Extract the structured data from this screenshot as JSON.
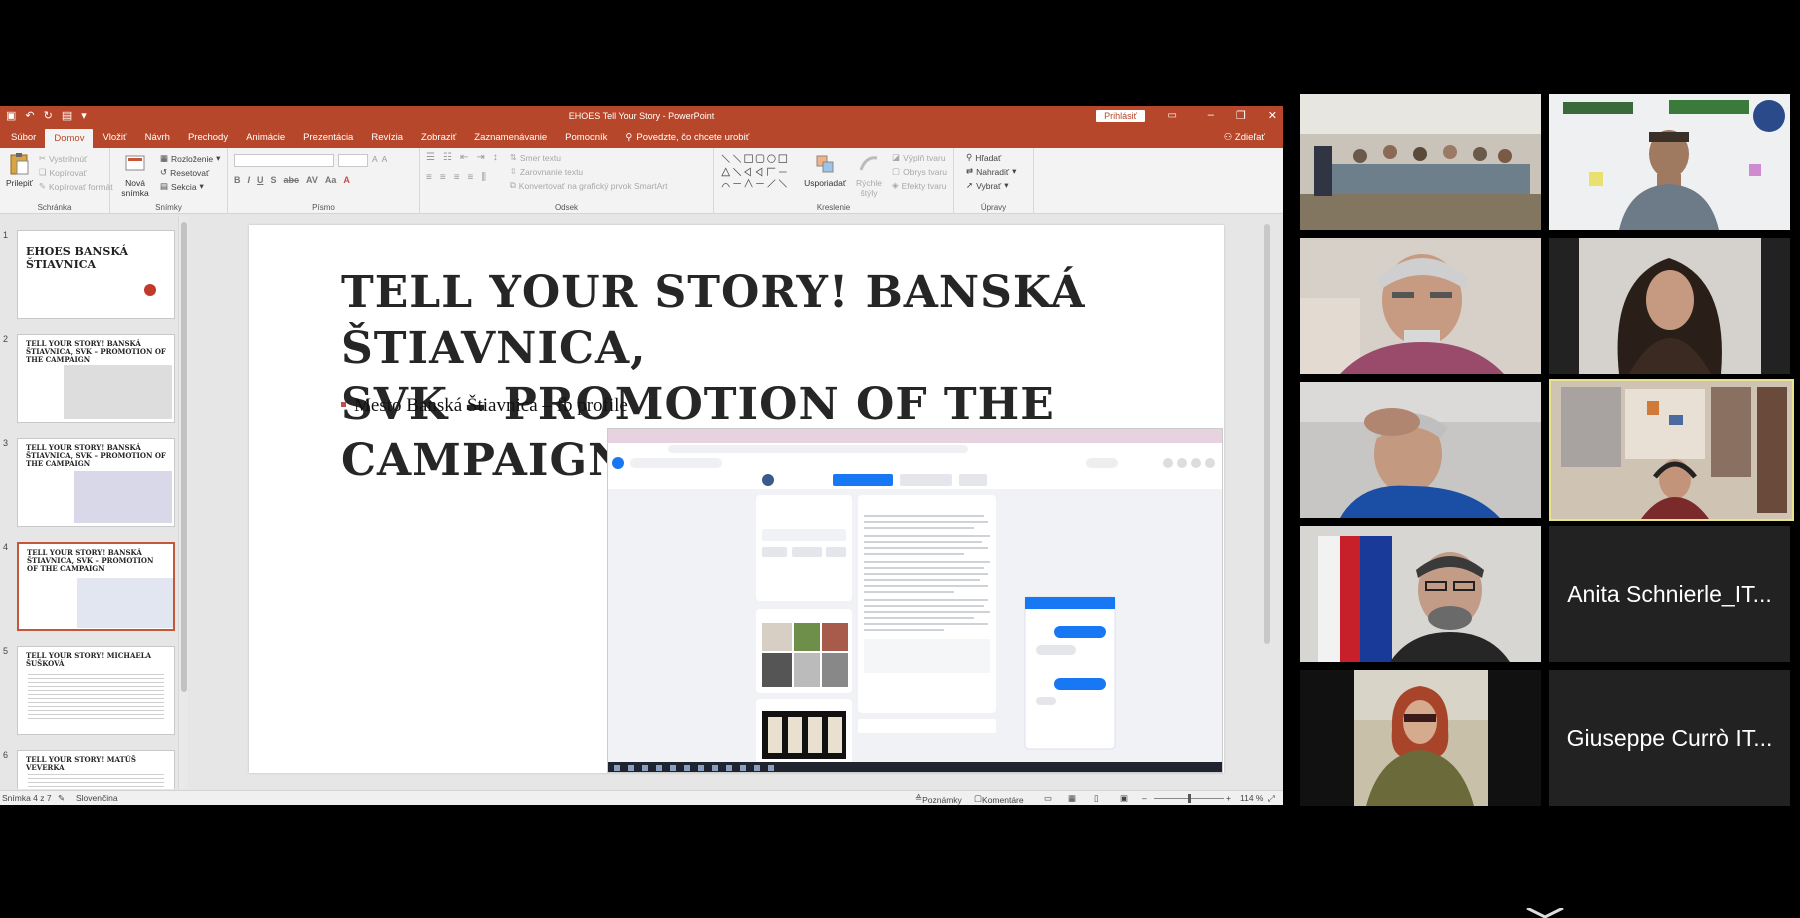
{
  "window": {
    "title": "EHOES Tell Your Story - PowerPoint",
    "signin": "Prihlásiť",
    "share": "Zdieľať"
  },
  "tabs": [
    "Súbor",
    "Domov",
    "Vložiť",
    "Návrh",
    "Prechody",
    "Animácie",
    "Prezentácia",
    "Revízia",
    "Zobraziť",
    "Zaznamenávanie",
    "Pomocník"
  ],
  "tellme": "Povedzte, čo chcete urobiť",
  "ribbon": {
    "schranka": {
      "label": "Schránka",
      "paste": "Prilepiť",
      "cut": "Vystrihnúť",
      "copy": "Kopírovať",
      "painter": "Kopírovať formát"
    },
    "snimky": {
      "label": "Snímky",
      "new": "Nová snímka",
      "layout": "Rozloženie",
      "reset": "Resetovať",
      "section": "Sekcia"
    },
    "pismo": {
      "label": "Písmo"
    },
    "odsek": {
      "label": "Odsek",
      "textdir": "Smer textu",
      "align": "Zarovnanie textu",
      "smartart": "Konvertovať na grafický prvok SmartArt"
    },
    "kreslenie": {
      "label": "Kreslenie",
      "arrange": "Usporiadať",
      "quick": "Rýchle štýly",
      "fill": "Výplň tvaru",
      "outline": "Obrys tvaru",
      "effects": "Efekty tvaru"
    },
    "upravy": {
      "label": "Úpravy",
      "find": "Hľadať",
      "replace": "Nahradiť",
      "select": "Vybrať"
    }
  },
  "thumbnails": [
    {
      "num": "1",
      "text": "EHOES BANSKÁ ŠTIAVNICA"
    },
    {
      "num": "2",
      "text": "TELL YOUR STORY! BANSKÁ ŠTIAVNICA, SVK – PROMOTION OF THE CAMPAIGN"
    },
    {
      "num": "3",
      "text": "TELL YOUR STORY! BANSKÁ ŠTIAVNICA, SVK – PROMOTION OF THE CAMPAIGN"
    },
    {
      "num": "4",
      "text": "TELL YOUR STORY! BANSKÁ ŠTIAVNICA, SVK – PROMOTION OF THE CAMPAIGN"
    },
    {
      "num": "5",
      "text": "TELL YOUR STORY! MICHAELA ŠUŠKOVÁ"
    },
    {
      "num": "6",
      "text": "TELL YOUR STORY! MATÚŠ VEVERKA"
    }
  ],
  "slide": {
    "title_line1": "TELL YOUR STORY! BANSKÁ ŠTIAVNICA,",
    "title_line2": "SVK – PROMOTION OF THE CAMPAIGN",
    "bullet": "Mesto Banská Štiavnica – fb profile"
  },
  "status": {
    "slide": "Snímka 4 z 7",
    "lang": "Slovenčina",
    "notes": "Poznámky",
    "comments": "Komentáre",
    "zoom": "114 %"
  },
  "participants": [
    {
      "name": "Anita Schnierle_IT..."
    },
    {
      "name": "Giuseppe Currò IT..."
    }
  ],
  "colors": {
    "accent": "#b7472a",
    "highlight": "#e8e28a"
  }
}
